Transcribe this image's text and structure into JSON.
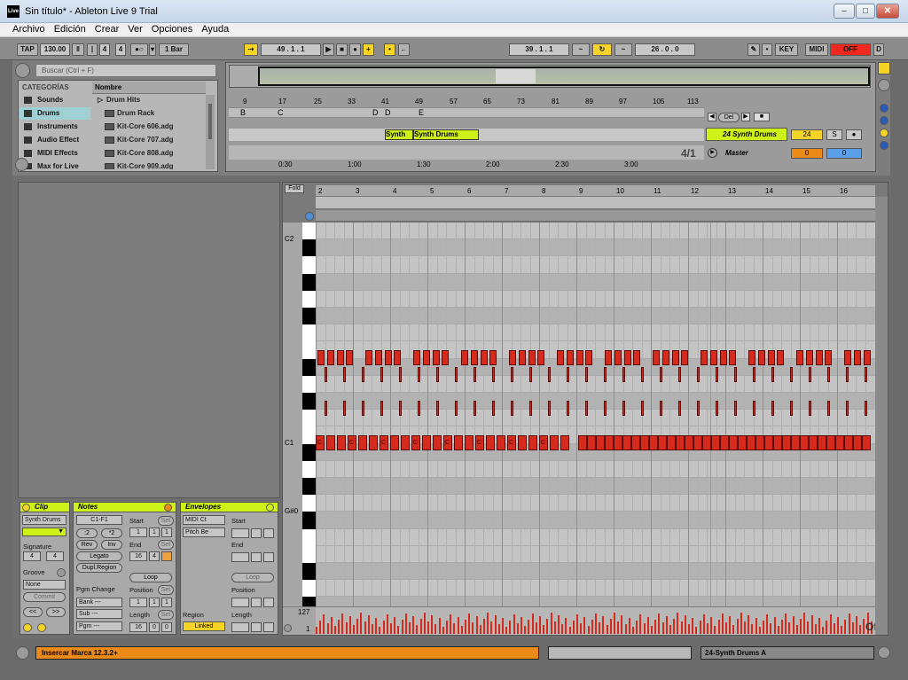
{
  "window": {
    "title": "Sin título* - Ableton Live 9 Trial",
    "app_icon": "Live"
  },
  "menu": [
    "Archivo",
    "Edición",
    "Crear",
    "Ver",
    "Opciones",
    "Ayuda"
  ],
  "transport": {
    "tap": "TAP",
    "tempo": "130.00",
    "sig_num": "4",
    "sig_den": "4",
    "quant": "1 Bar",
    "position": "49 . 1 . 1",
    "loop_start": "39 . 1 . 1",
    "loop_length": "26 . 0 . 0",
    "key": "KEY",
    "midi": "MIDI",
    "cpu": "OFF",
    "d": "D"
  },
  "browser": {
    "search_placeholder": "Buscar (Ctrl + F)",
    "categories_header": "CATEGORÍAS",
    "categories": [
      "Sounds",
      "Drums",
      "Instruments",
      "Audio Effect",
      "MIDI Effects",
      "Max for Live"
    ],
    "selected_category": "Drums",
    "name_header": "Nombre",
    "items": [
      "Drum Hits",
      "Drum Rack",
      "Kit-Core 606.adg",
      "Kit-Core 707.adg",
      "Kit-Core 808.adg",
      "Kit-Core 909.adg"
    ]
  },
  "arrangement": {
    "ruler": [
      "9",
      "17",
      "25",
      "33",
      "41",
      "49",
      "57",
      "65",
      "73",
      "81",
      "89",
      "97",
      "105",
      "113"
    ],
    "locators": [
      "B",
      "C",
      "D",
      "D",
      "E"
    ],
    "time_ruler": [
      "0:30",
      "1:00",
      "1:30",
      "2:00",
      "2:30",
      "3:00"
    ],
    "clip1": "Synth D",
    "clip2": "Synth Drums",
    "zoom_label": "4/1",
    "del_label": "Del",
    "track_name": "24 Synth Drums",
    "track_number": "24",
    "solo": "S",
    "master_name": "Master",
    "master_a": "0",
    "master_b": "0"
  },
  "clip": {
    "clip_header": "Clip",
    "clip_name": "Synth Drums",
    "signature_label": "Signature",
    "sig_num": "4",
    "sig_den": "4",
    "groove_label": "Groove",
    "groove_value": "None",
    "commit": "Commit",
    "notes_header": "Notes",
    "notes_range": "C1-F1",
    "start_label": "Start",
    "set_label": "Set",
    "div2": ":2",
    "mul2": "*2",
    "rev": "Rev",
    "inv": "Inv",
    "legato": "Legato",
    "dupl": "Dupl.Region",
    "end_label": "End",
    "loop_label": "Loop",
    "pgm_change": "Pgm Change",
    "position_label": "Position",
    "bank": "Bank ---",
    "sub": "Sub ---",
    "pgm": "Pgm ---",
    "length_label": "Length",
    "start_vals": [
      "1",
      "1",
      "1"
    ],
    "end_vals": [
      "16",
      "4",
      ""
    ],
    "pos_vals": [
      "1",
      "1",
      "1"
    ],
    "len_vals": [
      "16",
      "0",
      "0"
    ],
    "env_header": "Envelopes",
    "env_ctrl": "MIDI Ct",
    "env_param": "Pitch Be",
    "env_start": "Start",
    "env_end": "End",
    "env_loop": "Loop",
    "env_position": "Position",
    "env_region": "Region",
    "env_length": "Length",
    "linked": "Linked"
  },
  "midi_editor": {
    "fold": "Fold",
    "bars": [
      "2",
      "3",
      "4",
      "5",
      "6",
      "7",
      "8",
      "9",
      "10",
      "11",
      "12",
      "13",
      "14",
      "15",
      "16"
    ],
    "key_labels": {
      "c2": "C2",
      "c1": "C1",
      "gs0": "G#0"
    },
    "vel_max": "127",
    "vel_min": "1",
    "off": "Off"
  },
  "status": {
    "text": "Insercar Marca 12.3.2+",
    "track": "24-Synth Drums A"
  },
  "colors": {
    "accent": "#cef218",
    "note": "#d62a1c",
    "orange": "#ec8a17"
  }
}
